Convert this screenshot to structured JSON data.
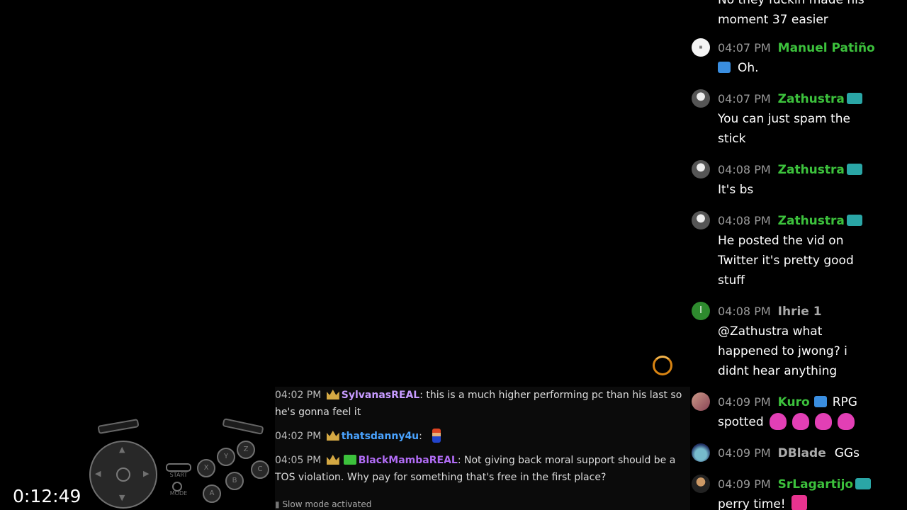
{
  "stream": {
    "timer": "0:12:49"
  },
  "controller": {
    "start_label": "START",
    "mode_label": "MODE",
    "buttons": [
      "X",
      "Y",
      "Z",
      "B",
      "C",
      "A"
    ]
  },
  "overlay_chat": {
    "messages": [
      {
        "time": "04:02 PM",
        "user": "SylvanasREAL",
        "user_color": "#c79bff",
        "separator": ":",
        "text": "this is a much higher performing pc than his last so he's gonna feel it"
      },
      {
        "time": "04:02 PM",
        "user": "thatsdanny4u",
        "user_color": "#4aa3ff",
        "separator": ":",
        "text": ""
      },
      {
        "time": "04:05 PM",
        "user": "BlackMambaREAL",
        "user_color": "#b16cf5",
        "separator": ":",
        "text": "Not giving back moral support should be a TOS violation. Why pay for something that's free in the first place?"
      }
    ],
    "slow_mode": "Slow mode activated"
  },
  "chat": {
    "top_fragment": "No they fuckin made his",
    "top_fragment_2": "moment 37 easier",
    "messages": [
      {
        "time": "04:07 PM",
        "user": "Manuel Patiño",
        "text": "Oh."
      },
      {
        "time": "04:07 PM",
        "user": "Zathustra",
        "text": "You can just spam the stick"
      },
      {
        "time": "04:08 PM",
        "user": "Zathustra",
        "text": "It's bs"
      },
      {
        "time": "04:08 PM",
        "user": "Zathustra",
        "text": "He posted the vid on Twitter it's pretty good stuff"
      },
      {
        "time": "04:08 PM",
        "user": "Ihrie 1",
        "avatar_letter": "I",
        "text": "@Zathustra what happened to jwong? i didnt hear anything"
      },
      {
        "time": "04:09 PM",
        "user": "Kuro",
        "text_inline": "RPG",
        "text": "spotted"
      },
      {
        "time": "04:09 PM",
        "user": "DBlade",
        "text_inline": "GGs"
      },
      {
        "time": "04:09 PM",
        "user": "SrLagartijo",
        "text": "perry time!"
      }
    ]
  },
  "colors": {
    "username_green": "#3cc13c",
    "username_grey": "#aaaaaa",
    "timestamp": "#9a9a9a",
    "spinner": "#d98412"
  }
}
